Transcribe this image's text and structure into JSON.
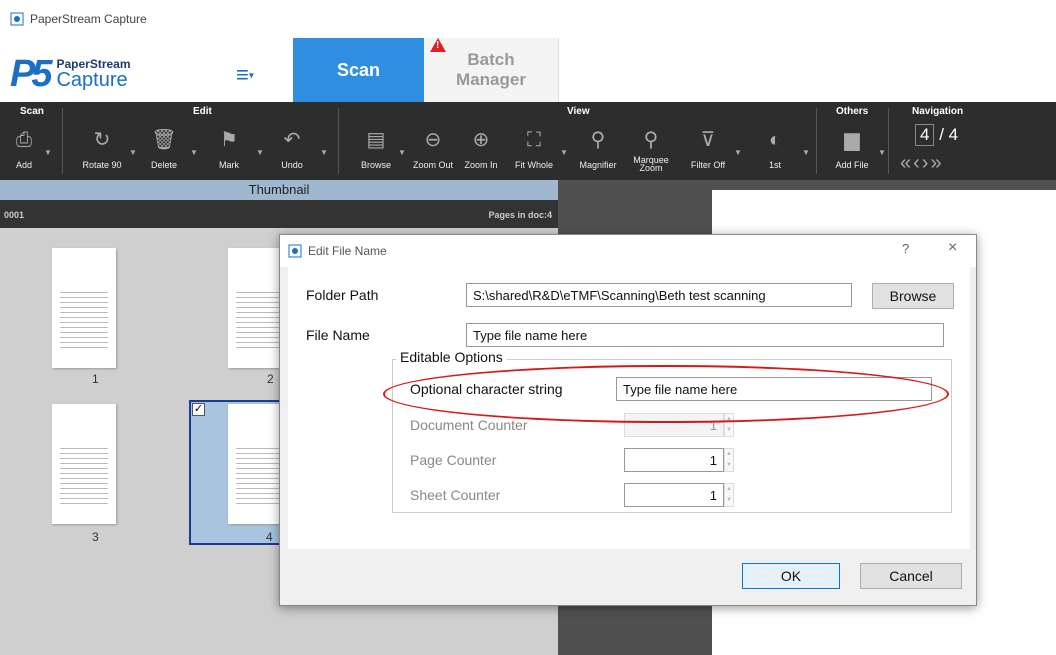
{
  "window": {
    "title": "PaperStream Capture"
  },
  "header": {
    "logo_top": "PaperStream",
    "logo_bottom": "Capture",
    "logo_mark": "P5",
    "menu_icon": "hamburger-menu-icon",
    "tabs": [
      {
        "label": "Scan",
        "active": true
      },
      {
        "label_line1": "Batch",
        "label_line2": "Manager",
        "active": false
      }
    ],
    "warning_icon": "warning-triangle-icon"
  },
  "ribbon": {
    "groups": {
      "scan": "Scan",
      "edit": "Edit",
      "view": "View",
      "others": "Others",
      "navigation": "Navigation"
    },
    "tools": {
      "add": "Add",
      "rotate": "Rotate 90",
      "delete": "Delete",
      "mark": "Mark",
      "undo": "Undo",
      "browse": "Browse",
      "zoom_out": "Zoom Out",
      "zoom_in": "Zoom In",
      "fit_whole": "Fit Whole",
      "magnifier": "Magnifier",
      "marquee_zoom_1": "Marquee",
      "marquee_zoom_2": "Zoom",
      "filter_off": "Filter Off",
      "first": "1st",
      "add_file": "Add File"
    },
    "navigation": {
      "current": "4",
      "separator": "/",
      "total": "4"
    }
  },
  "thumbnail_pane": {
    "header": "Thumbnail",
    "doc_id": "0001",
    "pages_in_doc": "Pages in doc:4",
    "pages": [
      "1",
      "2",
      "3",
      "4"
    ],
    "selected_page": "4"
  },
  "dialog": {
    "title": "Edit File Name",
    "help": "?",
    "close": "×",
    "folder_path_label": "Folder Path",
    "folder_path_value": "S:\\shared\\R&D\\eTMF\\Scanning\\Beth test scanning",
    "browse_button": "Browse",
    "file_name_label": "File Name",
    "file_name_value": "Type file name here",
    "editable_options_legend": "Editable Options",
    "optional_string_label": "Optional character string",
    "optional_string_value": "Type file name here",
    "document_counter_label": "Document Counter",
    "document_counter_value": "1",
    "page_counter_label": "Page Counter",
    "page_counter_value": "1",
    "sheet_counter_label": "Sheet Counter",
    "sheet_counter_value": "1",
    "ok_button": "OK",
    "cancel_button": "Cancel"
  },
  "colors": {
    "scan_tab": "#2f8ee0",
    "ribbon_bg": "#2d2d2d",
    "annotation_red": "#d81818",
    "selected_thumb": "#a8c4de"
  }
}
